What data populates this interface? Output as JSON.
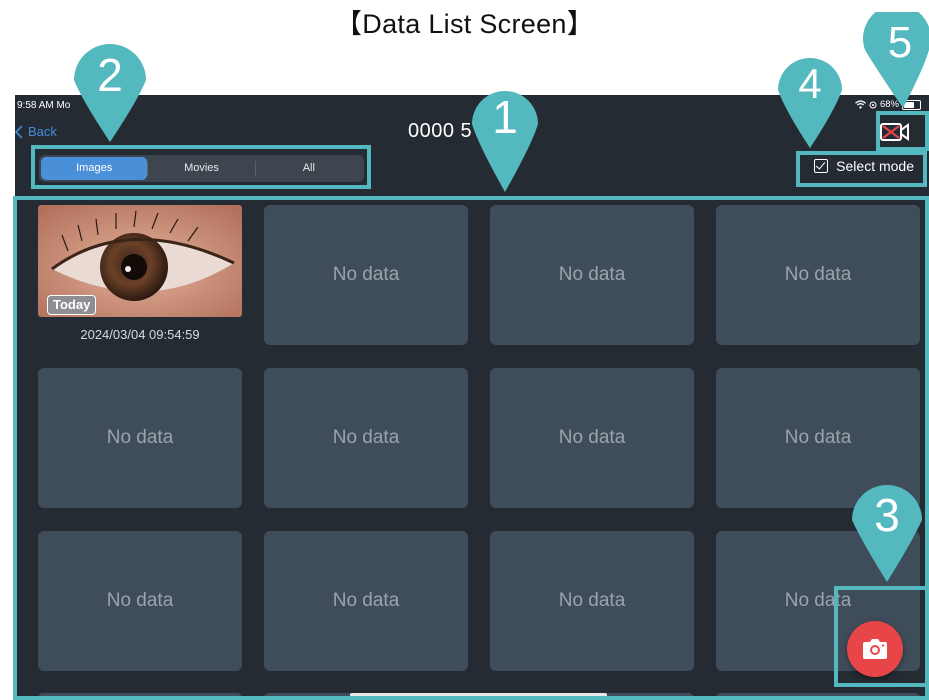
{
  "page_title": "【Data List Screen】",
  "status_bar": {
    "time": "9:58 AM  Mo",
    "battery": "68%",
    "battery_level": 0.68
  },
  "nav": {
    "back_label": "Back",
    "title": "0000 5"
  },
  "filter_tabs": [
    {
      "label": "Images",
      "active": true
    },
    {
      "label": "Movies",
      "active": false
    },
    {
      "label": "All",
      "active": false
    }
  ],
  "select_mode": {
    "label": "Select mode",
    "checked": true
  },
  "grid": {
    "first_item": {
      "badge": "Today",
      "timestamp": "2024/03/04 09:54:59"
    },
    "empty_label": "No data",
    "rows_visible": 3,
    "columns": 4
  },
  "callouts": [
    "1",
    "2",
    "3",
    "4",
    "5"
  ],
  "icons": {
    "back": "chevron-left-icon",
    "camera_off": "video-camera-off-icon",
    "capture": "camera-icon",
    "wifi": "wifi-icon",
    "battery": "battery-icon"
  },
  "colors": {
    "accent": "#4a90d9",
    "callout": "#54b9bf",
    "capture": "#e84549",
    "background": "#252b33",
    "cell": "#3f4d5a"
  }
}
